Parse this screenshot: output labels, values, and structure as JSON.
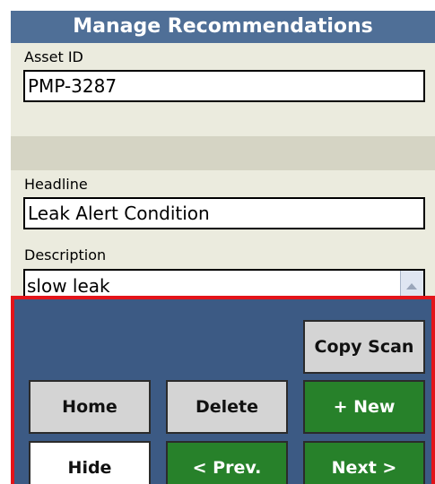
{
  "window": {
    "title": "Manage Recommendations"
  },
  "form": {
    "asset_id_label": "Asset ID",
    "asset_id_value": "PMP-3287",
    "headline_label": "Headline",
    "headline_value": "Leak Alert Condition",
    "description_label": "Description",
    "description_value": "slow leak"
  },
  "buttons": {
    "copy_scan": "Copy Scan",
    "home": "Home",
    "delete": "Delete",
    "new": "+ New",
    "hide": "Hide",
    "prev": "< Prev.",
    "next": "Next >"
  },
  "colors": {
    "title_bar": "#4f6f97",
    "button_panel": "#3c5a84",
    "panel_border": "#e3141a",
    "green_button": "#27812a",
    "gray_button": "#d4d4d4"
  }
}
